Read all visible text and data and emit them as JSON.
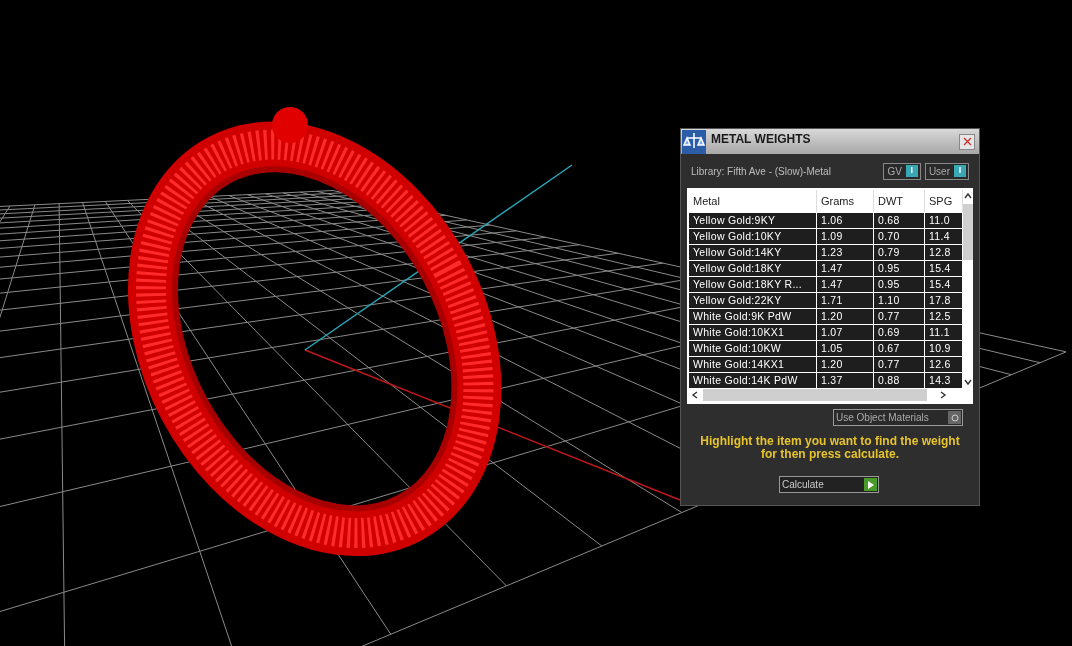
{
  "panel": {
    "title": "METAL WEIGHTS",
    "library": "Library: Fifth Ave - (Slow)-Metal",
    "toggles": [
      {
        "label": "GV",
        "glyph": "I"
      },
      {
        "label": "User",
        "glyph": "I"
      }
    ],
    "table": {
      "columns": [
        "Metal",
        "Grams",
        "DWT",
        "SPG"
      ],
      "rows": [
        [
          "Yellow Gold:9KY",
          "1.06",
          "0.68",
          "11.0"
        ],
        [
          "Yellow Gold:10KY",
          "1.09",
          "0.70",
          "11.4"
        ],
        [
          "Yellow Gold:14KY",
          "1.23",
          "0.79",
          "12.8"
        ],
        [
          "Yellow Gold:18KY",
          "1.47",
          "0.95",
          "15.4"
        ],
        [
          "Yellow Gold:18KY R...",
          "1.47",
          "0.95",
          "15.4"
        ],
        [
          "Yellow Gold:22KY",
          "1.71",
          "1.10",
          "17.8"
        ],
        [
          "White Gold:9K PdW",
          "1.20",
          "0.77",
          "12.5"
        ],
        [
          "White Gold:10KX1",
          "1.07",
          "0.69",
          "11.1"
        ],
        [
          "White Gold:10KW",
          "1.05",
          "0.67",
          "10.9"
        ],
        [
          "White Gold:14KX1",
          "1.20",
          "0.77",
          "12.6"
        ],
        [
          "White Gold:14K PdW",
          "1.37",
          "0.88",
          "14.3"
        ]
      ]
    },
    "option": "Use Object Materials",
    "message": "Highlight the item you want to find the weight for then press calculate.",
    "button": "Calculate"
  }
}
